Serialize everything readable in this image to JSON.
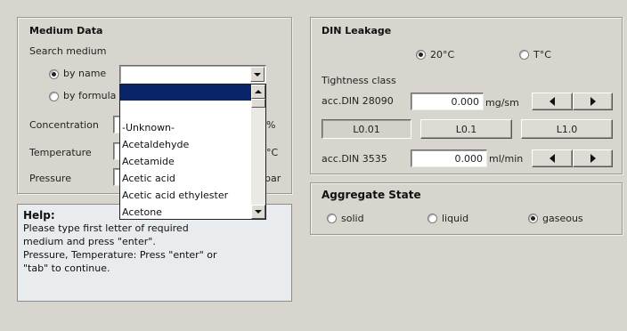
{
  "medium_data": {
    "title": "Medium Data",
    "search_label": "Search medium",
    "by_name_label": "by name",
    "by_formula_label": "by formula",
    "search_value": "",
    "concentration_label": "Concentration",
    "concentration_unit": "%",
    "temperature_label": "Temperature",
    "temperature_unit": "°C",
    "pressure_label": "Pressure",
    "pressure_unit": "bar",
    "dropdown_items": [
      "",
      "-Unknown-",
      "Acetaldehyde",
      "Acetamide",
      "Acetic acid",
      "Acetic acid ethylester",
      "Acetone"
    ]
  },
  "help": {
    "title": "Help:",
    "lines": [
      "Please type first letter of required",
      "medium and press \"enter\".",
      "Pressure, Temperature: Press \"enter\" or",
      "\"tab\" to continue."
    ]
  },
  "din_leakage": {
    "title": "DIN Leakage",
    "temp_20_label": "20°C",
    "temp_t_label": "T°C",
    "tightness_label": "Tightness class",
    "din28090_label": "acc.DIN 28090",
    "din28090_value": "0.000",
    "din28090_unit": "mg/sm",
    "btn_l001": "L0.01",
    "btn_l01": "L0.1",
    "btn_l10": "L1.0",
    "din3535_label": "acc.DIN 3535",
    "din3535_value": "0.000",
    "din3535_unit": "ml/min"
  },
  "aggregate_state": {
    "title": "Aggregate State",
    "solid_label": "solid",
    "liquid_label": "liquid",
    "gaseous_label": "gaseous",
    "selected": "gaseous"
  },
  "colors": {
    "background": "#d8d5ce",
    "selection": "#0a246a",
    "help_background": "#e8ecee"
  }
}
